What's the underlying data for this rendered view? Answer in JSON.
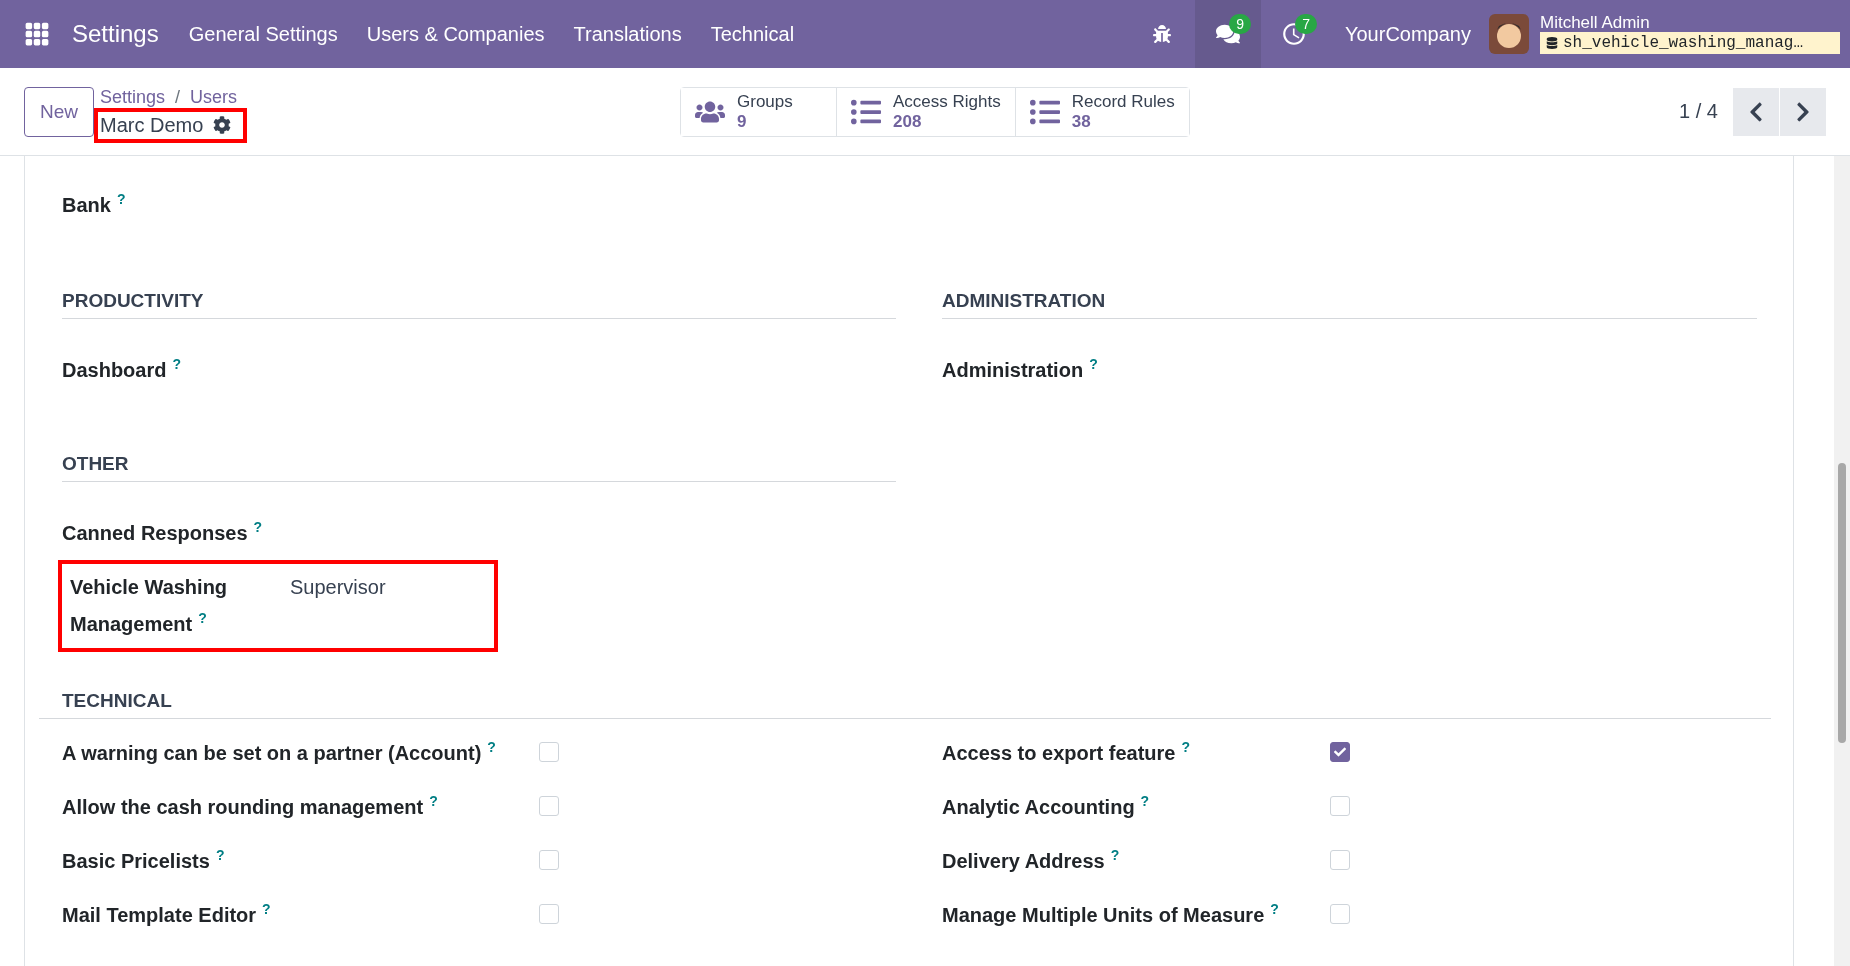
{
  "navbar": {
    "app": "Settings",
    "menu": [
      "General Settings",
      "Users & Companies",
      "Translations",
      "Technical"
    ],
    "messages_count": "9",
    "activities_count": "7",
    "company": "YourCompany",
    "user": "Mitchell Admin",
    "database": "sh_vehicle_washing_manag…"
  },
  "control_panel": {
    "new_button": "New",
    "breadcrumb": [
      "Settings",
      "Users"
    ],
    "breadcrumb_separator": "/",
    "record_title": "Marc Demo",
    "title_highlighted": true,
    "smart_buttons": [
      {
        "label": "Groups",
        "count": "9",
        "kind": "groups"
      },
      {
        "label": "Access Rights",
        "count": "208",
        "kind": "list"
      },
      {
        "label": "Record Rules",
        "count": "38",
        "kind": "list"
      }
    ],
    "pager": "1 / 4"
  },
  "top_fields": [
    {
      "label": "Bank",
      "help": "?"
    }
  ],
  "sections": [
    {
      "title": "PRODUCTIVITY",
      "fields": [
        {
          "label": "Dashboard",
          "help": "?"
        }
      ]
    },
    {
      "title": "ADMINISTRATION",
      "fields": [
        {
          "label": "Administration",
          "help": "?"
        }
      ]
    },
    {
      "title": "OTHER",
      "fields": [
        {
          "label": "Canned Responses",
          "help": "?",
          "highlighted": false
        },
        {
          "label": "Vehicle Washing Management",
          "help": "?",
          "value": "Supervisor",
          "highlighted": true
        }
      ]
    }
  ],
  "technical": {
    "title": "TECHNICAL",
    "left": [
      {
        "label": "A warning can be set on a partner (Account)",
        "help": "?",
        "checked": false
      },
      {
        "label": "Allow the cash rounding management",
        "help": "?",
        "checked": false
      },
      {
        "label": "Basic Pricelists",
        "help": "?",
        "checked": false
      },
      {
        "label": "Mail Template Editor",
        "help": "?",
        "checked": false
      }
    ],
    "right": [
      {
        "label": "Access to export feature",
        "help": "?",
        "checked": true
      },
      {
        "label": "Analytic Accounting",
        "help": "?",
        "checked": false
      },
      {
        "label": "Delivery Address",
        "help": "?",
        "checked": false
      },
      {
        "label": "Manage Multiple Units of Measure",
        "help": "?",
        "checked": false
      }
    ]
  }
}
